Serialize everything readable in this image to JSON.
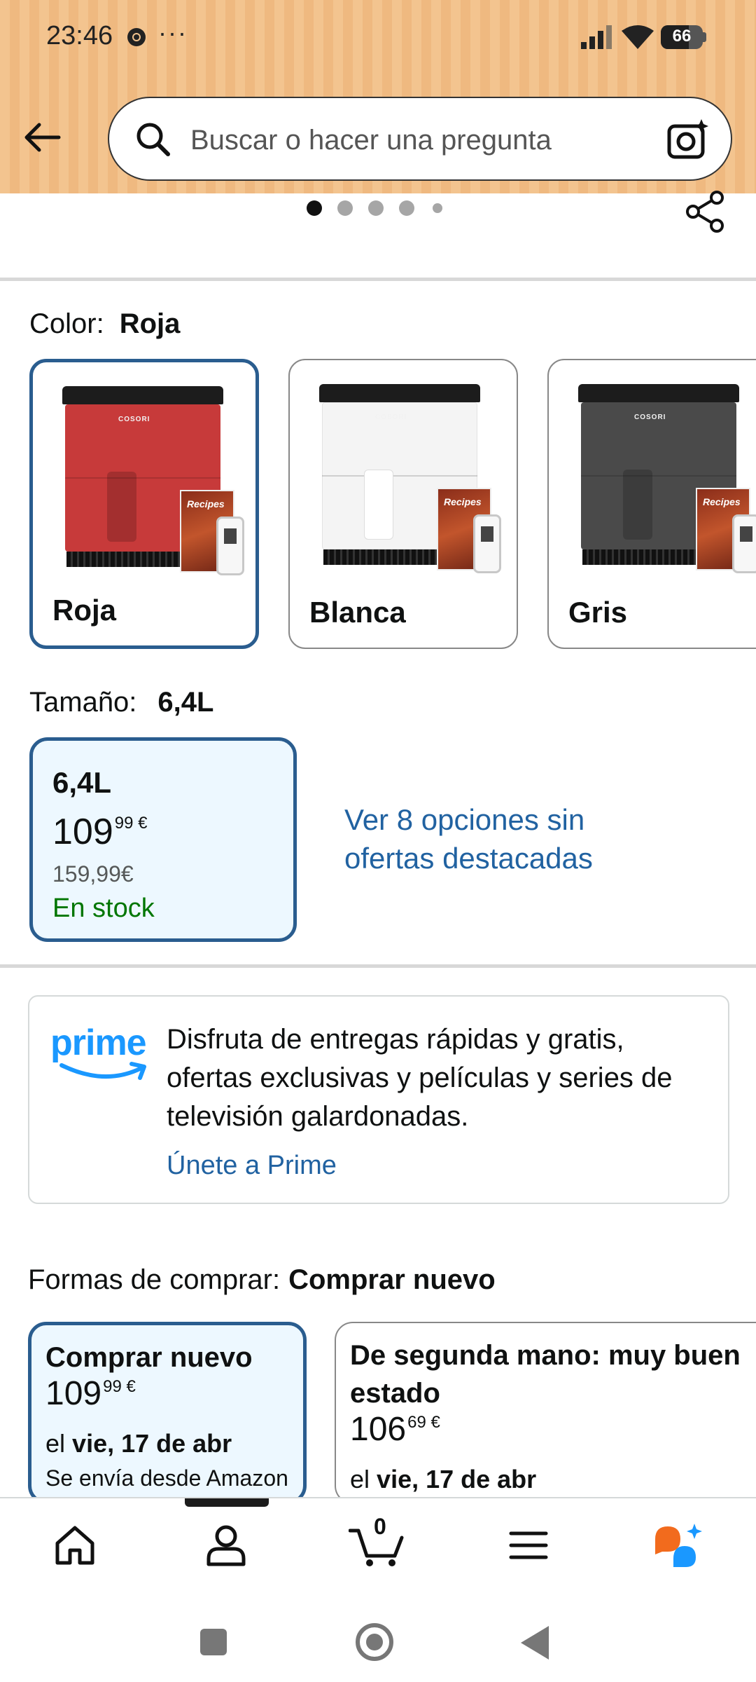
{
  "status_bar": {
    "time": "23:46",
    "dots": "···",
    "battery": "66",
    "battery_level_percent": 66
  },
  "search": {
    "placeholder": "Buscar o hacer una pregunta"
  },
  "carousel": {
    "dot_count": 5,
    "active_index": 0
  },
  "color": {
    "label": "Color:",
    "selected": "Roja",
    "options": [
      {
        "name": "Roja",
        "body_color": "#c73a3a",
        "selected": true
      },
      {
        "name": "Blanca",
        "body_color": "#f4f4f4",
        "selected": false
      },
      {
        "name": "Gris",
        "body_color": "#4a4a4a",
        "selected": false
      }
    ],
    "brand": "COSORI",
    "book_title": "Recipes"
  },
  "size": {
    "label": "Tamaño:",
    "selected": "6,4L",
    "card": {
      "name": "6,4L",
      "price_whole": "109",
      "price_fraction": "99 €",
      "old_price": "159,99€",
      "stock": "En stock"
    },
    "more_options": "Ver 8 opciones sin ofertas destacadas"
  },
  "prime": {
    "logo_text": "prime",
    "description": "Disfruta de entregas rápidas y gratis, ofertas exclusivas y películas y series de televisión galardonadas.",
    "join_link": "Únete a Prime"
  },
  "buy": {
    "label": "Formas de comprar:",
    "selected": "Comprar nuevo",
    "new": {
      "title": "Comprar nuevo",
      "price_whole": "109",
      "price_fraction": "99 €",
      "delivery_prefix": "el",
      "delivery_date": "vie, 17 de abr",
      "ships_from": "Se envía desde Amazon"
    },
    "used": {
      "title_line1": "De segunda mano: muy buen",
      "title_line2": "estado",
      "price_whole": "106",
      "price_fraction": "69 €",
      "delivery_prefix": "el",
      "delivery_date": "vie, 17 de abr"
    }
  },
  "bottom_nav": {
    "cart_count": "0",
    "items": [
      "home",
      "account",
      "cart",
      "menu",
      "rufus"
    ]
  },
  "colors": {
    "header": "#f3c48f",
    "link": "#2162a1",
    "selected_border": "#2a5d8f",
    "selected_bg": "#edf8ff",
    "in_stock": "#007600",
    "prime_blue": "#1a98ff",
    "rufus_orange": "#f26b1d",
    "rufus_blue": "#1a98ff"
  }
}
